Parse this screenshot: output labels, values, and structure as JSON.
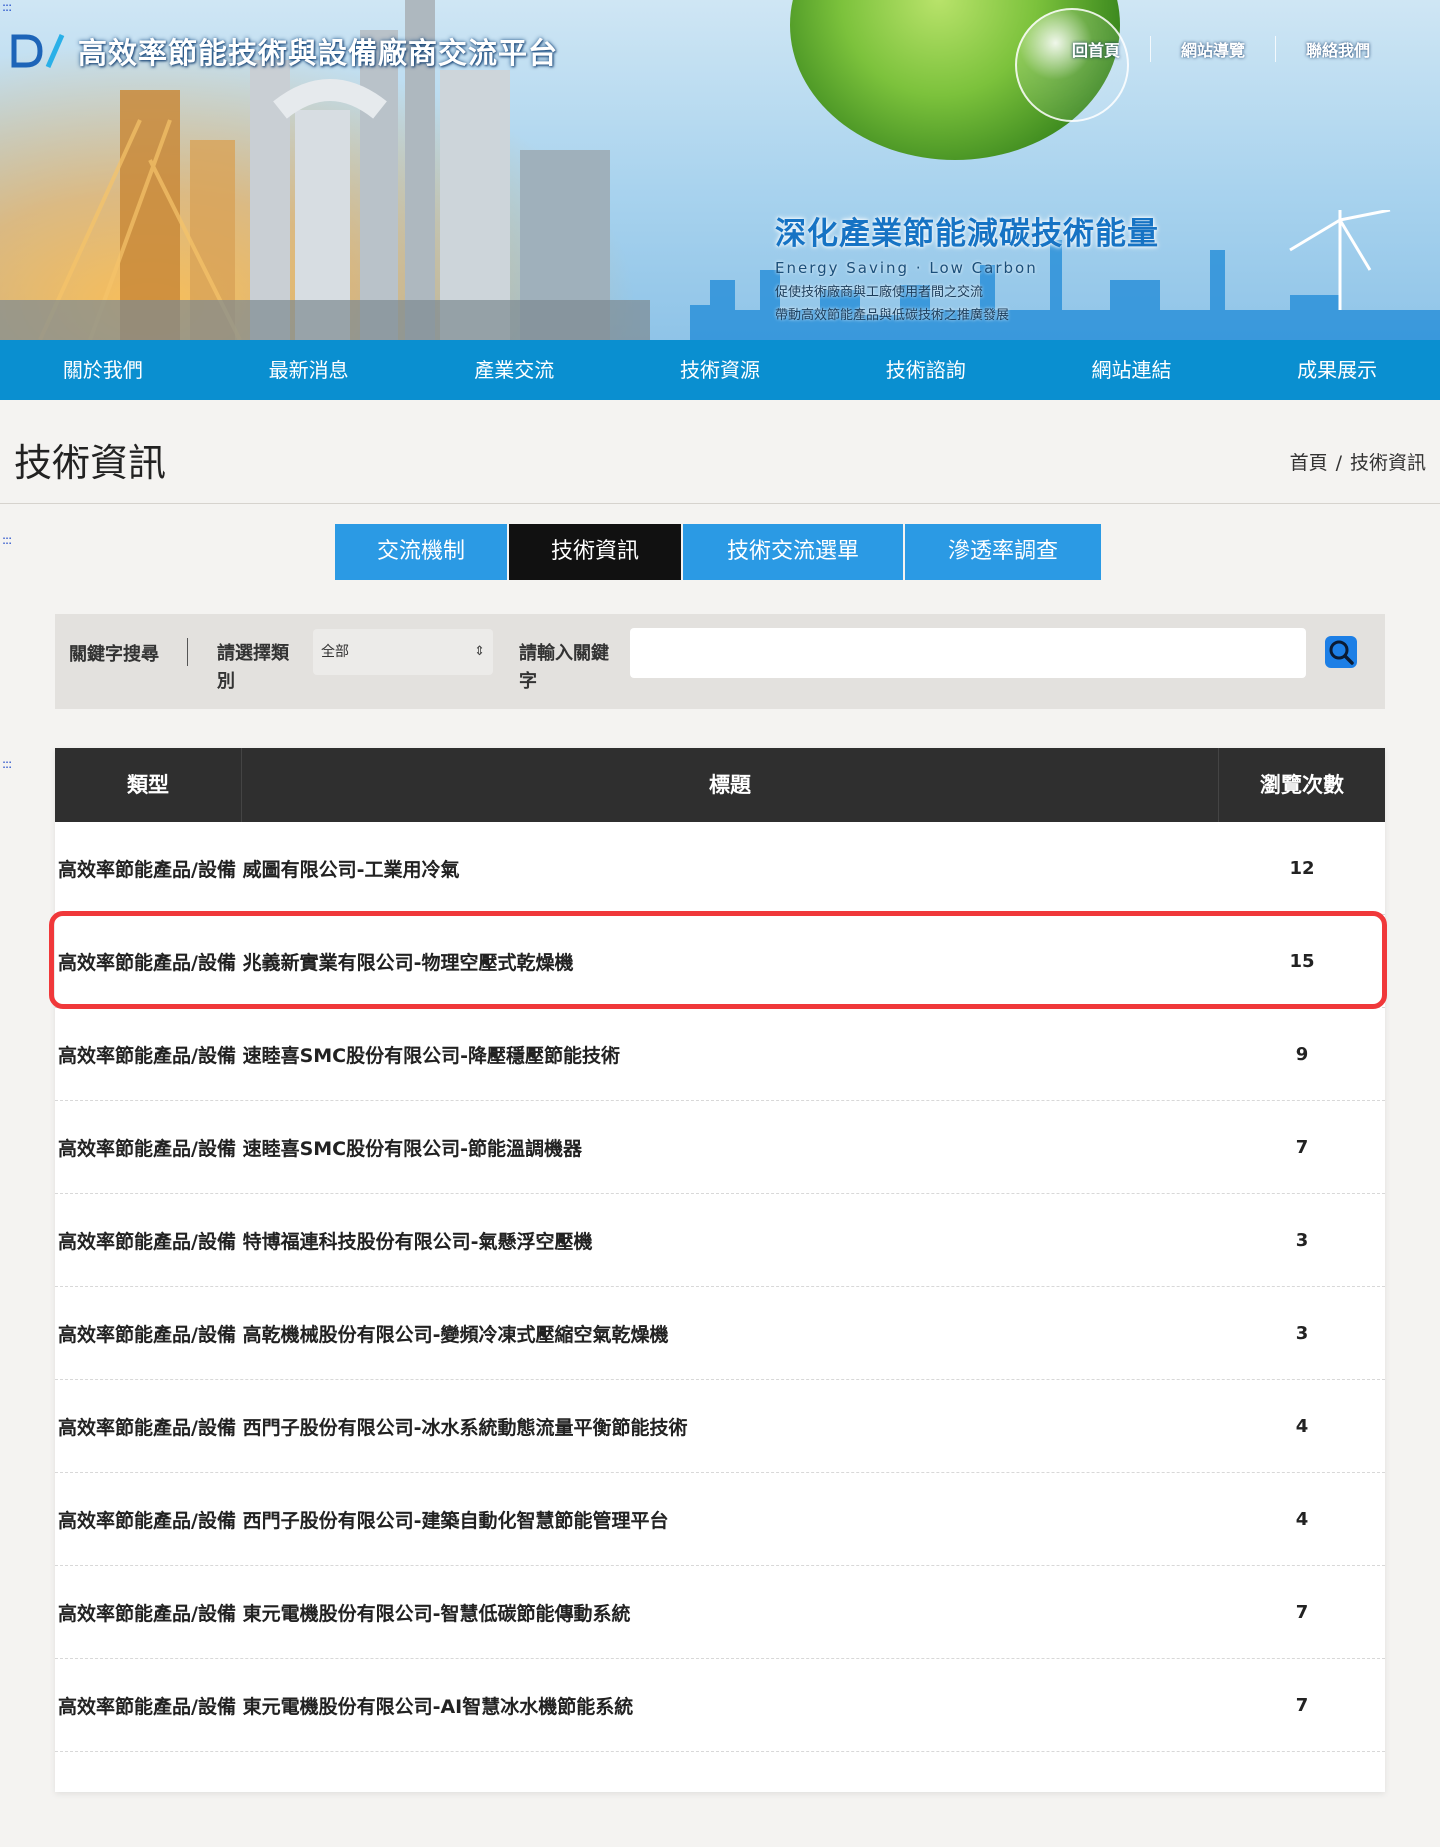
{
  "site": {
    "title": "高效率節能技術與設備廠商交流平台",
    "top_links": [
      "回首頁",
      "網站導覽",
      "聯絡我們"
    ]
  },
  "slogan": {
    "main": "深化產業節能減碳技術能量",
    "en": "Energy Saving · Low Carbon",
    "line1": "促使技術廠商與工廠使用者間之交流",
    "line2": "帶動高效節能產品與低碳技術之推廣發展"
  },
  "nav": [
    "關於我們",
    "最新消息",
    "產業交流",
    "技術資源",
    "技術諮詢",
    "網站連結",
    "成果展示"
  ],
  "page": {
    "title": "技術資訊",
    "breadcrumb_home": "首頁",
    "breadcrumb_divider": "/",
    "breadcrumb_current": "技術資訊",
    "anchor": ":::"
  },
  "sub_tabs": [
    {
      "label": "交流機制",
      "active": false
    },
    {
      "label": "技術資訊",
      "active": true
    },
    {
      "label": "技術交流選單",
      "active": false
    },
    {
      "label": "滲透率調查",
      "active": false
    }
  ],
  "search": {
    "label": "關鍵字搜尋",
    "category_label": "請選擇類別",
    "category_value": "全部",
    "keyword_label": "請輸入關鍵字",
    "keyword_value": ""
  },
  "table": {
    "headers": {
      "type": "類型",
      "title": "標題",
      "views": "瀏覽次數"
    },
    "rows": [
      {
        "category": "高效率節能產品/設備",
        "title": "威圖有限公司-工業用冷氣",
        "views": "12"
      },
      {
        "category": "高效率節能產品/設備",
        "title": "兆義新實業有限公司-物理空壓式乾燥機",
        "views": "15"
      },
      {
        "category": "高效率節能產品/設備",
        "title": "速睦喜SMC股份有限公司-降壓穩壓節能技術",
        "views": "9"
      },
      {
        "category": "高效率節能產品/設備",
        "title": "速睦喜SMC股份有限公司-節能溫調機器",
        "views": "7"
      },
      {
        "category": "高效率節能產品/設備",
        "title": "特博福連科技股份有限公司-氣懸浮空壓機",
        "views": "3"
      },
      {
        "category": "高效率節能產品/設備",
        "title": "高乾機械股份有限公司-變頻冷凍式壓縮空氣乾燥機",
        "views": "3"
      },
      {
        "category": "高效率節能產品/設備",
        "title": "西門子股份有限公司-冰水系統動態流量平衡節能技術",
        "views": "4"
      },
      {
        "category": "高效率節能產品/設備",
        "title": "西門子股份有限公司-建築自動化智慧節能管理平台",
        "views": "4"
      },
      {
        "category": "高效率節能產品/設備",
        "title": "東元電機股份有限公司-智慧低碳節能傳動系統",
        "views": "7"
      },
      {
        "category": "高效率節能產品/設備",
        "title": "東元電機股份有限公司-AI智慧冰水機節能系統",
        "views": "7"
      }
    ]
  },
  "colors": {
    "nav_blue": "#0a8fd0",
    "tab_blue": "#2b9ae4",
    "tab_active": "#111111",
    "table_header": "#2f2f2f",
    "highlight": "#f0383a"
  }
}
